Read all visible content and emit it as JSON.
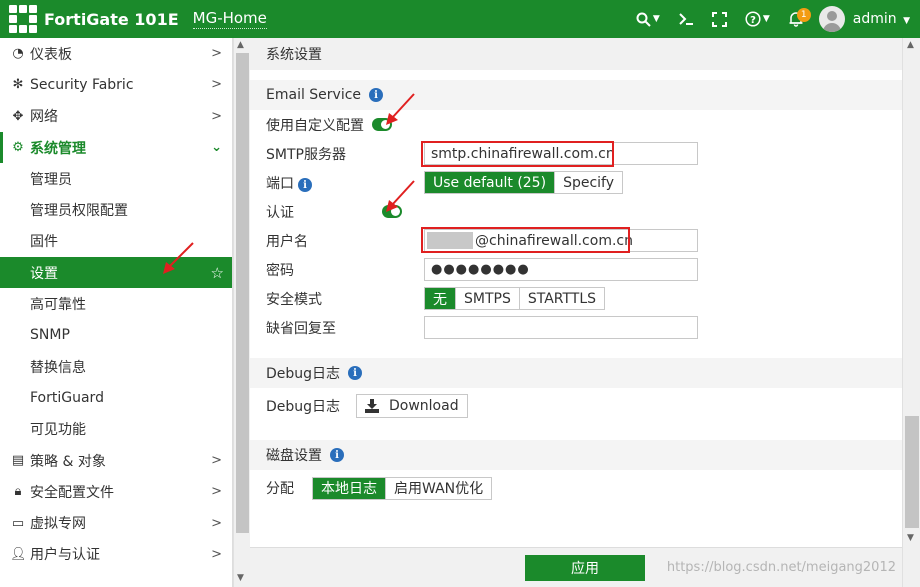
{
  "header": {
    "product": "FortiGate 101E",
    "hostname": "MG-Home",
    "user": "admin",
    "notification_count": "1",
    "icons": [
      "search-icon",
      "terminal-icon",
      "fullscreen-icon",
      "help-icon",
      "bell-icon"
    ]
  },
  "sidebar": {
    "items": [
      {
        "label": "仪表板",
        "icon": "dashboard-icon"
      },
      {
        "label": "Security Fabric",
        "icon": "fabric-icon"
      },
      {
        "label": "网络",
        "icon": "network-icon"
      },
      {
        "label": "系统管理",
        "icon": "gear-icon"
      },
      {
        "label": "策略 & 对象",
        "icon": "policy-icon"
      },
      {
        "label": "安全配置文件",
        "icon": "lock-icon"
      },
      {
        "label": "虚拟专网",
        "icon": "monitor-icon"
      },
      {
        "label": "用户与认证",
        "icon": "user-icon"
      }
    ],
    "sub_items": [
      "管理员",
      "管理员权限配置",
      "固件",
      "设置",
      "高可靠性",
      "SNMP",
      "替换信息",
      "FortiGuard",
      "可见功能"
    ],
    "active_sub": "设置"
  },
  "main": {
    "page_title": "系统设置",
    "email_service": {
      "title": "Email Service",
      "use_custom_label": "使用自定义配置",
      "smtp_label": "SMTP服务器",
      "smtp_value": "smtp.chinafirewall.com.cn",
      "port_label": "端口",
      "port_options": [
        "Use default (25)",
        "Specify"
      ],
      "auth_label": "认证",
      "username_label": "用户名",
      "username_value": "@chinafirewall.com.cn",
      "password_label": "密码",
      "password_value": "●●●●●●●●",
      "security_label": "安全模式",
      "security_options": [
        "无",
        "SMTPS",
        "STARTTLS"
      ],
      "reply_to_label": "缺省回复至",
      "reply_to_value": ""
    },
    "debug": {
      "title": "Debug日志",
      "row_label": "Debug日志",
      "download_label": "Download"
    },
    "disk": {
      "title": "磁盘设置",
      "alloc_label": "分配",
      "alloc_options": [
        "本地日志",
        "启用WAN优化"
      ]
    }
  },
  "footer": {
    "apply_label": "应用",
    "watermark": "https://blog.csdn.net/meigang2012"
  },
  "colors": {
    "brand_green": "#1b8a2b",
    "annotation_red": "#e02020",
    "info_blue": "#2a6ebb"
  }
}
